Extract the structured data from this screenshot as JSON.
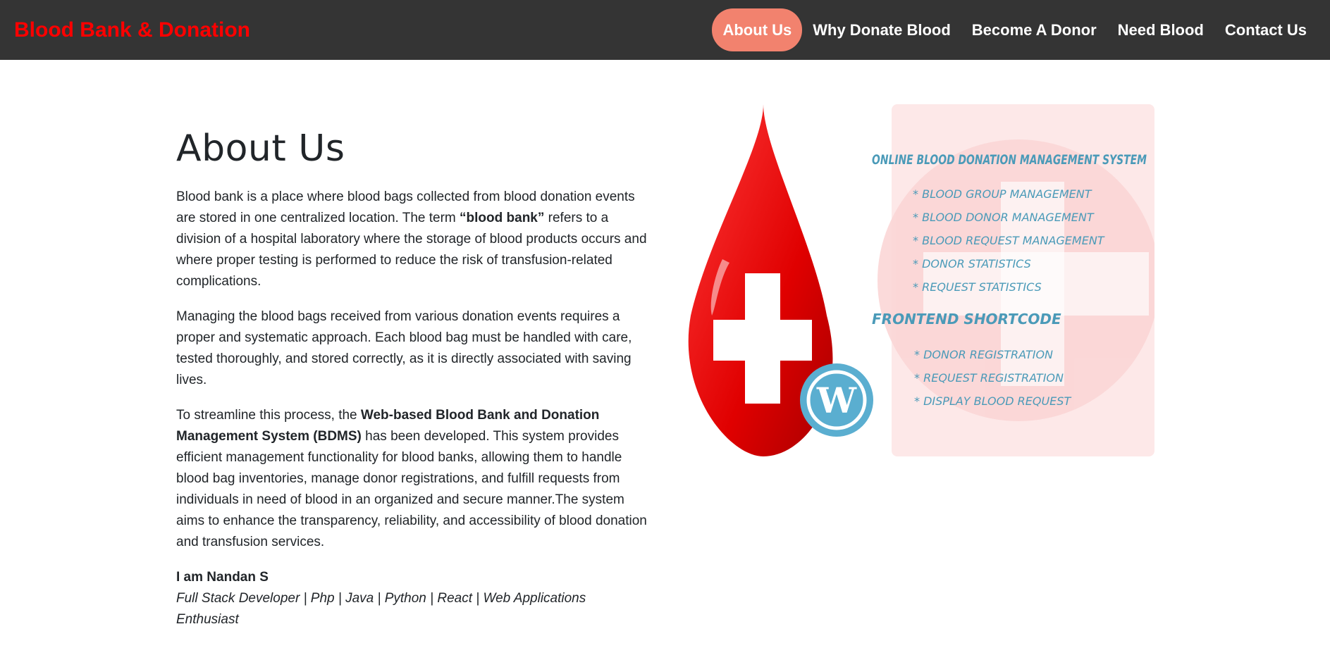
{
  "navbar": {
    "brand": "Blood Bank & Donation",
    "items": [
      {
        "label": "About Us",
        "active": true
      },
      {
        "label": "Why Donate Blood"
      },
      {
        "label": "Become A Donor"
      },
      {
        "label": "Need Blood"
      },
      {
        "label": "Contact Us"
      }
    ]
  },
  "about": {
    "title": "About Us",
    "p1_a": "Blood bank is a place where blood bags collected from blood donation events are stored in one centralized location. The term ",
    "p1_b": "“blood bank”",
    "p1_c": " refers to a division of a hospital laboratory where the storage of blood products occurs and where proper testing is performed to reduce the risk of transfusion-related complications.",
    "p2": "Managing the blood bags received from various donation events requires a proper and systematic approach. Each blood bag must be handled with care, tested thoroughly, and stored correctly, as it is directly associated with saving lives.",
    "p3_a": "To streamline this process, the ",
    "p3_b": "Web-based Blood Bank and Donation Management System (BDMS)",
    "p3_c": " has been developed. This system provides efficient management functionality for blood banks, allowing them to handle blood bag inventories, manage donor registrations, and fulfill requests from individuals in need of blood in an organized and secure manner.The system aims to enhance the transparency, reliability, and accessibility of blood donation and transfusion services.",
    "author_name": "I am Nandan S",
    "author_role": "Full Stack Developer | Php | Java | Python | React | Web Applications Enthusiast"
  },
  "hero": {
    "heading1": "ONLINE BLOOD DONATION MANAGEMENT SYSTEM",
    "features1": [
      "BLOOD GROUP MANAGEMENT",
      "BLOOD DONOR MANAGEMENT",
      "BLOOD REQUEST MANAGEMENT",
      "DONOR STATISTICS",
      "REQUEST STATISTICS"
    ],
    "heading2": "FRONTEND  SHORTCODE",
    "features2": [
      "DONOR REGISTRATION",
      "REQUEST REGISTRATION",
      "DISPLAY BLOOD REQUEST"
    ],
    "colors": {
      "drop": "#e00000",
      "wp_badge": "#5aaed0",
      "text": "#4a9ab8",
      "bg_tint": "#fde8e8"
    }
  },
  "theme": {
    "navbar_bg": "#343434",
    "brand": "#ff0000",
    "active_pill": "#f2826e"
  }
}
